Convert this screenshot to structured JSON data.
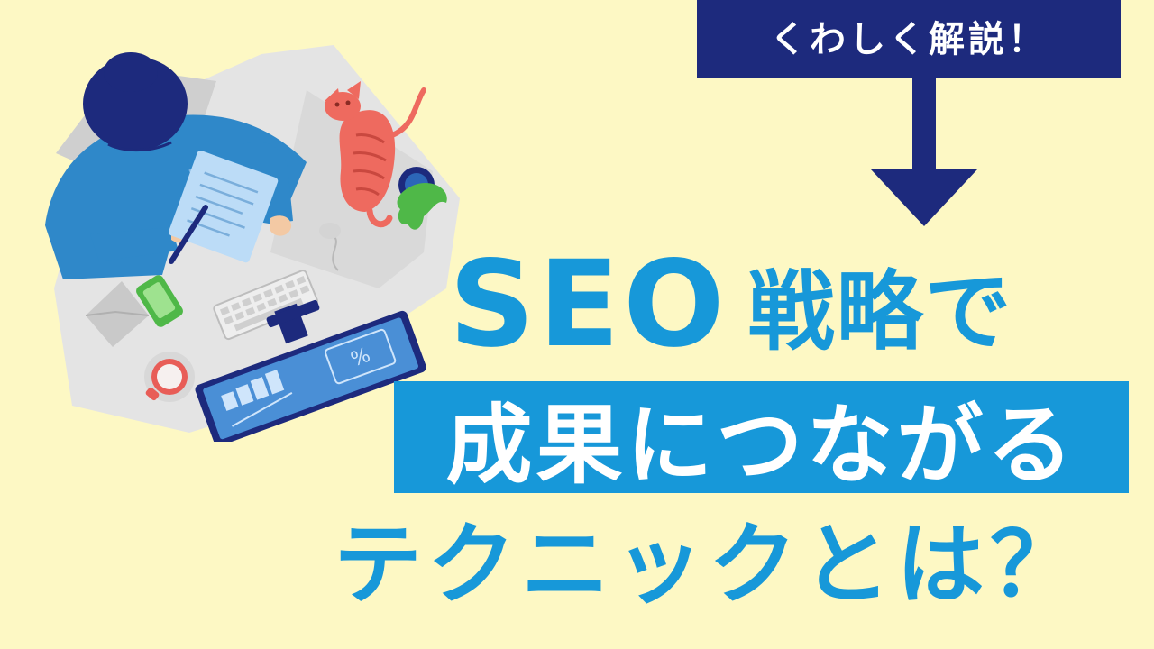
{
  "banner": {
    "label": "くわしく解説！"
  },
  "headline": {
    "line1_latin": "SEO",
    "line1_jp": "戦略で",
    "line2": "成果につながる",
    "line3": "テクニックとは？"
  },
  "illustration": {
    "percent_label": "%"
  },
  "colors": {
    "background": "#fdf8c4",
    "navy": "#1d2a7d",
    "accent_blue": "#1798d9",
    "white": "#ffffff"
  },
  "icons": [
    "down-arrow-icon",
    "person-at-desk-illustration",
    "cat-icon",
    "plant-icon",
    "phone-icon",
    "envelope-icon",
    "keyboard-icon",
    "mouse-icon",
    "coffee-cup-icon",
    "monitor-icon"
  ]
}
